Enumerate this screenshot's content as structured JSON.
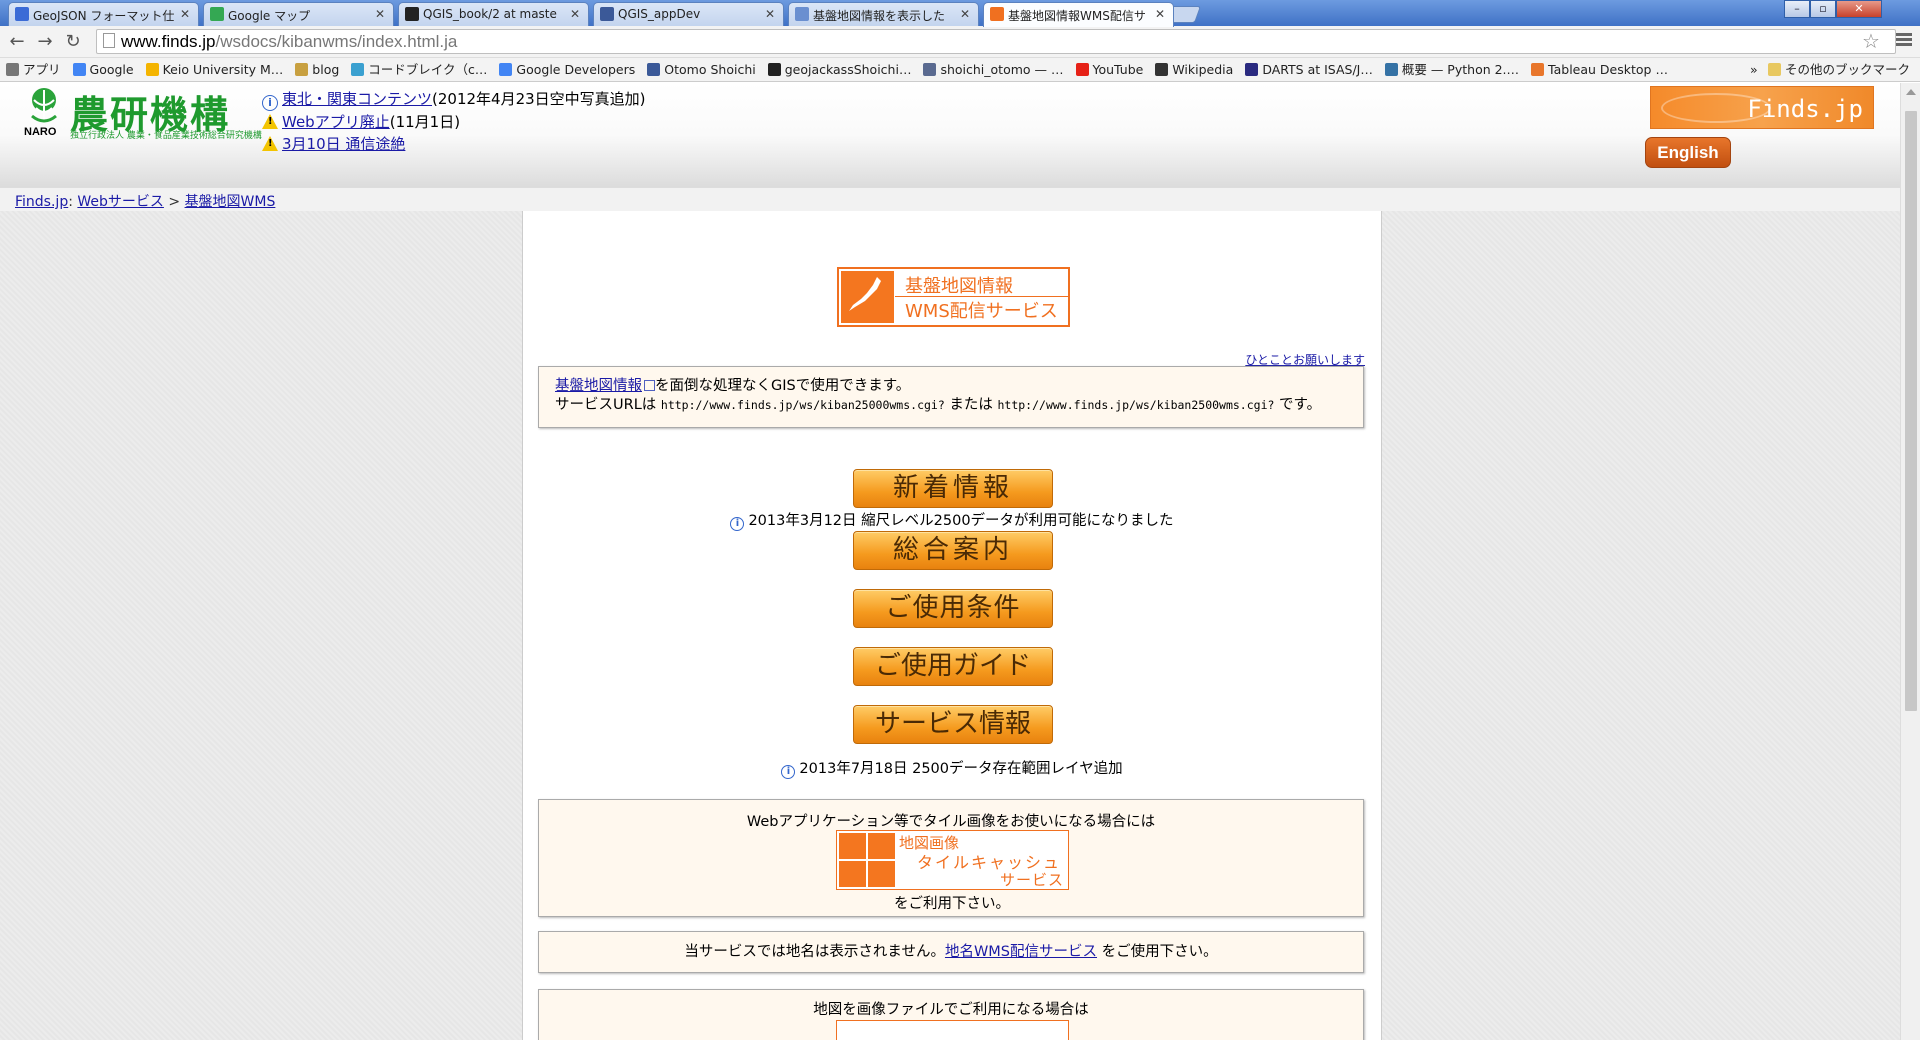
{
  "browser": {
    "tabs": [
      {
        "title": "GeoJSON フォーマット仕",
        "favicon_color": "#3b6bd6",
        "active": false
      },
      {
        "title": "Google マップ",
        "favicon_color": "#34a853",
        "active": false
      },
      {
        "title": "QGIS_book/2 at maste",
        "favicon_color": "#222222",
        "active": false
      },
      {
        "title": "QGIS_appDev",
        "favicon_color": "#3b5998",
        "active": false
      },
      {
        "title": "基盤地図情報を表示した",
        "favicon_color": "#6a8fd0",
        "active": false
      },
      {
        "title": "基盤地図情報WMS配信サ",
        "favicon_color": "#f07020",
        "active": true
      }
    ],
    "url_host": "www.finds.jp",
    "url_path": "/wsdocs/kibanwms/index.html.ja",
    "bookmarks": [
      {
        "label": "アプリ",
        "icon_color": "#777777"
      },
      {
        "label": "Google",
        "icon_color": "#4285f4"
      },
      {
        "label": "Keio University M…",
        "icon_color": "#f4b400"
      },
      {
        "label": "blog",
        "icon_color": "#c8a040"
      },
      {
        "label": "コードブレイク（c…",
        "icon_color": "#3aa0d0"
      },
      {
        "label": "Google Developers",
        "icon_color": "#4285f4"
      },
      {
        "label": "Otomo Shoichi",
        "icon_color": "#3b5998"
      },
      {
        "label": "geojackassShoichi…",
        "icon_color": "#222222"
      },
      {
        "label": "shoichi_otomo — …",
        "icon_color": "#5a6a90"
      },
      {
        "label": "YouTube",
        "icon_color": "#e62117"
      },
      {
        "label": "Wikipedia",
        "icon_color": "#333333"
      },
      {
        "label": "DARTS at ISAS/J…",
        "icon_color": "#2a2a80"
      },
      {
        "label": "概要 — Python 2.…",
        "icon_color": "#3572a5"
      },
      {
        "label": "Tableau Desktop …",
        "icon_color": "#e8762b"
      }
    ],
    "bookmarks_more": "»",
    "bookmarks_other": "その他のブックマーク"
  },
  "header": {
    "logo_text": "農研機構",
    "logo_naro": "NARO",
    "logo_sub": "独立行政法人 農業・食品産業技術総合研究機構",
    "notices": [
      {
        "icon": "info-icon",
        "link": "東北・関東コンテンツ",
        "text": "(2012年4月23日空中写真追加)"
      },
      {
        "icon": "warning-icon",
        "link": "Webアプリ廃止",
        "text": "(11月1日)"
      },
      {
        "icon": "warning-icon",
        "link": "3月10日 通信途絶",
        "text": ""
      }
    ],
    "finds_banner": "Finds.jp",
    "english_button": "English"
  },
  "breadcrumb": {
    "items": [
      "Finds.jp",
      "Webサービス",
      "基盤地図WMS"
    ],
    "sep1": ":",
    "sep2": ">"
  },
  "main": {
    "title_line1": "基盤地図情報",
    "title_line2": "WMS配信サービス",
    "hitokoto": "ひとことお願いします",
    "intro_link": "基盤地図情報",
    "intro_text1": "を面倒な処理なくGISで使用できます。",
    "intro_text2": "サービスURLは ",
    "url1": "http://www.finds.jp/ws/kiban25000wms.cgi?",
    "intro_mid": " または ",
    "url2": "http://www.finds.jp/ws/kiban2500wms.cgi?",
    "intro_end": " です。",
    "buttons": {
      "news": "新着情報",
      "overview": "総合案内",
      "terms": "ご使用条件",
      "guide": "ご使用ガイド",
      "service": "サービス情報"
    },
    "news_caption": "2013年3月12日 縮尺レベル2500データが利用可能になりました",
    "service_caption": "2013年7月18日 2500データ存在範囲レイヤ追加",
    "tile_intro": "Webアプリケーション等でタイル画像をお使いになる場合には",
    "tile_l1": "地図画像",
    "tile_l2": "タイルキャッシュ",
    "tile_l3": "サービス",
    "tile_after": "をご利用下さい。",
    "placename_pre": "当サービスでは地名は表示されません。",
    "placename_link": "地名WMS配信サービス",
    "placename_post": " をご使用下さい。",
    "image_intro": "地図を画像ファイルでご利用になる場合は"
  }
}
